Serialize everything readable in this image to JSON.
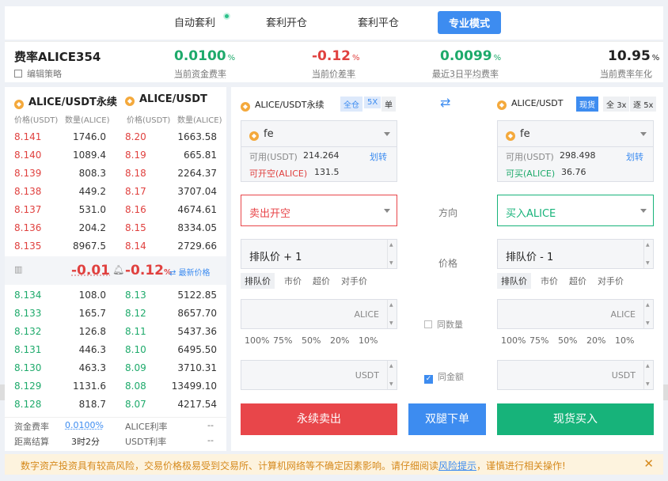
{
  "tabs": [
    {
      "label": "自动套利"
    },
    {
      "label": "套利开仓"
    },
    {
      "label": "套利平仓"
    },
    {
      "label": "专业模式"
    }
  ],
  "header": {
    "title": "费率ALICE354",
    "edit_label": "编辑策略",
    "stats": [
      {
        "value": "0.0100",
        "unit": "%",
        "label": "当前资金费率"
      },
      {
        "value": "-0.12",
        "unit": "%",
        "label": "当前价差率"
      },
      {
        "value": "0.0099",
        "unit": "%",
        "label": "最近3日平均费率"
      },
      {
        "value": "10.95",
        "unit": "%",
        "label": "当前费率年化"
      }
    ]
  },
  "book": {
    "left_title": "ALICE/USDT永续",
    "right_title": "ALICE/USDT",
    "col_headers": [
      "价格(USDT)",
      "数量(ALICE)",
      "价格(USDT)",
      "数量(ALICE)"
    ],
    "asks": [
      [
        "8.141",
        "1746.0",
        "8.20",
        "1663.58"
      ],
      [
        "8.140",
        "1089.4",
        "8.19",
        "665.81"
      ],
      [
        "8.139",
        "808.3",
        "8.18",
        "2264.37"
      ],
      [
        "8.138",
        "449.2",
        "8.17",
        "3707.04"
      ],
      [
        "8.137",
        "531.0",
        "8.16",
        "4674.61"
      ],
      [
        "8.136",
        "204.2",
        "8.15",
        "8334.05"
      ],
      [
        "8.135",
        "8967.5",
        "8.14",
        "2729.66"
      ]
    ],
    "mid": {
      "diff": "-0.01",
      "rate": "-0.12",
      "rate_unit": "%",
      "latest_label": "最新价格"
    },
    "bids": [
      [
        "8.134",
        "108.0",
        "8.13",
        "5122.85"
      ],
      [
        "8.133",
        "165.7",
        "8.12",
        "8657.70"
      ],
      [
        "8.132",
        "126.8",
        "8.11",
        "5437.36"
      ],
      [
        "8.131",
        "446.3",
        "8.10",
        "6495.50"
      ],
      [
        "8.130",
        "463.3",
        "8.09",
        "3710.31"
      ],
      [
        "8.129",
        "1131.6",
        "8.08",
        "13499.10"
      ],
      [
        "8.128",
        "818.7",
        "8.07",
        "4217.54"
      ]
    ],
    "footer": {
      "funding_label": "资金费率",
      "funding_value": "0.0100%",
      "alice_rate_label": "ALICE利率",
      "alice_rate_value": "--",
      "settle_label": "距离结算",
      "settle_value": "3时2分",
      "usdt_rate_label": "USDT利率",
      "usdt_rate_value": "--"
    }
  },
  "left": {
    "pair": "ALICE/USDT永续",
    "badges": [
      "全仓",
      "5X",
      "单"
    ],
    "account": "fe",
    "available_label": "可用(USDT)",
    "available_value": "214.264",
    "transfer": "划转",
    "openable_label": "可开空(ALICE)",
    "openable_value": "131.5",
    "direction": "卖出开空",
    "price_value": "排队价 + 1",
    "price_types": [
      "排队价",
      "市价",
      "超价",
      "对手价"
    ],
    "qty_unit": "ALICE",
    "pcts": [
      "100%",
      "75%",
      "50%",
      "20%",
      "10%"
    ],
    "amt_unit": "USDT",
    "action": "永续卖出"
  },
  "right": {
    "pair": "ALICE/USDT",
    "badges": [
      "现货",
      "全",
      "3x",
      "逐",
      "5x"
    ],
    "account": "fe",
    "available_label": "可用(USDT)",
    "available_value": "298.498",
    "transfer": "划转",
    "buyable_label": "可买(ALICE)",
    "buyable_value": "36.76",
    "direction": "买入ALICE",
    "price_value": "排队价 - 1",
    "price_types": [
      "排队价",
      "市价",
      "超价",
      "对手价"
    ],
    "qty_unit": "ALICE",
    "pcts": [
      "100%",
      "75%",
      "50%",
      "20%",
      "10%"
    ],
    "amt_unit": "USDT",
    "action": "现货买入"
  },
  "center": {
    "direction_label": "方向",
    "price_label": "价格",
    "same_qty_label": "同数量",
    "same_amt_label": "同金额",
    "action": "双腿下单"
  },
  "notice": {
    "text": "数字资产投资具有较高风险，交易价格极易受到交易所、计算机网络等不确定因素影响。请仔细阅读",
    "link": "风险提示",
    "text2": "，谨慎进行相关操作!"
  },
  "colors": {
    "primary": "#3d8cf0",
    "green": "#1eaa6b",
    "red": "#e0413f",
    "sell": "#e8464a",
    "buy": "#17b37a"
  }
}
